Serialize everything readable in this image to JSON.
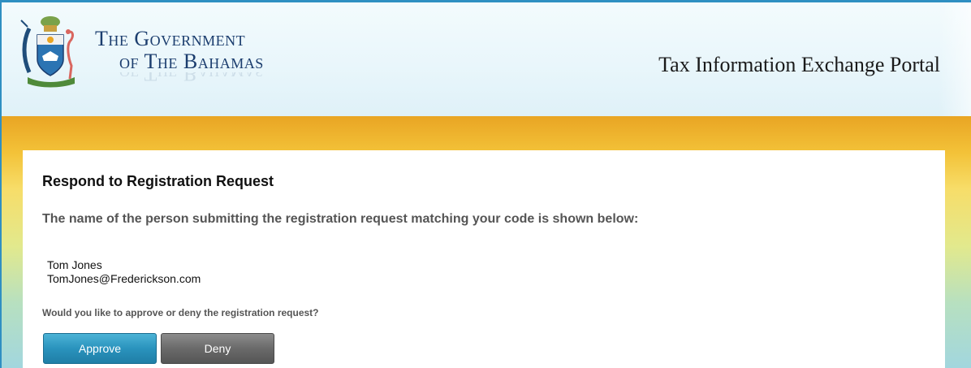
{
  "header": {
    "gov_line1": "The Government",
    "gov_line2": "of The Bahamas",
    "portal_title": "Tax Information Exchange Portal",
    "crest_icon": "bahamas-coat-of-arms-icon"
  },
  "main": {
    "heading": "Respond to Registration Request",
    "intro": "The name of the person submitting the registration request matching your code is shown below:",
    "person": {
      "name": "Tom Jones",
      "email": "TomJones@Frederickson.com"
    },
    "question": "Would you like to approve or deny the registration request?",
    "approve_label": "Approve",
    "deny_label": "Deny"
  },
  "colors": {
    "frame_accent": "#2f8fc2",
    "brand_text": "#1b3d6e",
    "approve_button": "#2a93bd",
    "deny_button": "#6a6a6a",
    "gold_band": "#f3c238"
  }
}
